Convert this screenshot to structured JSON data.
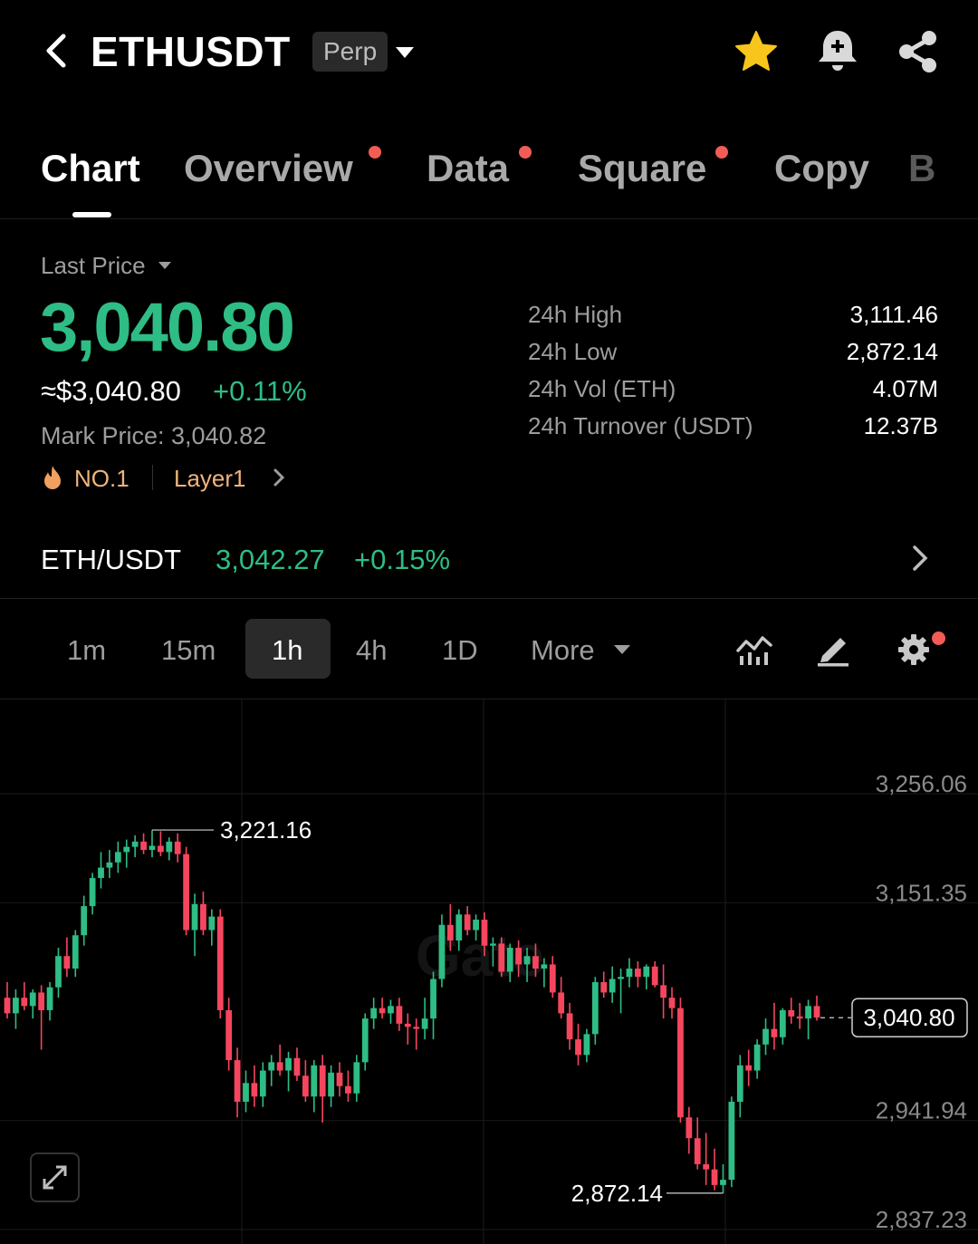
{
  "header": {
    "symbol": "ETHUSDT",
    "badge": "Perp"
  },
  "tabs": [
    {
      "label": "Chart",
      "active": true,
      "dot": false
    },
    {
      "label": "Overview",
      "active": false,
      "dot": true
    },
    {
      "label": "Data",
      "active": false,
      "dot": true
    },
    {
      "label": "Square",
      "active": false,
      "dot": true
    },
    {
      "label": "Copy",
      "active": false,
      "dot": false
    },
    {
      "label": "B",
      "active": false,
      "dot": false
    }
  ],
  "price": {
    "label": "Last Price",
    "last": "3,040.80",
    "usd": "≈$3,040.80",
    "change": "+0.11%",
    "mark": "Mark Price:  3,040.82",
    "rank": "NO.1",
    "tag": "Layer1"
  },
  "stats": [
    {
      "label": "24h High",
      "value": "3,111.46"
    },
    {
      "label": "24h Low",
      "value": "2,872.14"
    },
    {
      "label": "24h Vol (ETH)",
      "value": "4.07M"
    },
    {
      "label": "24h Turnover (USDT)",
      "value": "12.37B"
    }
  ],
  "spot": {
    "pair": "ETH/USDT",
    "price": "3,042.27",
    "change": "+0.15%"
  },
  "intervals": [
    {
      "label": "1m",
      "active": false
    },
    {
      "label": "15m",
      "active": false
    },
    {
      "label": "1h",
      "active": true
    },
    {
      "label": "4h",
      "active": false
    },
    {
      "label": "1D",
      "active": false
    },
    {
      "label": "More",
      "active": false
    }
  ],
  "colors": {
    "up": "#2ebd85",
    "down": "#f6465d",
    "accent": "#f0b47a",
    "dot": "#f25c54"
  },
  "chart_data": {
    "type": "candlestick",
    "y_ticks": [
      "3,256.06",
      "3,151.35",
      "2,941.94",
      "2,837.23"
    ],
    "ylim": [
      2830,
      3265
    ],
    "last_price_label": "3,040.80",
    "high_label": "3,221.16",
    "low_label": "2,872.14",
    "watermark": "Gate",
    "candles": [
      [
        3060,
        3075,
        3040,
        3045
      ],
      [
        3045,
        3068,
        3030,
        3060
      ],
      [
        3060,
        3075,
        3048,
        3052
      ],
      [
        3052,
        3068,
        3040,
        3065
      ],
      [
        3065,
        3072,
        3010,
        3048
      ],
      [
        3048,
        3075,
        3038,
        3070
      ],
      [
        3070,
        3108,
        3060,
        3100
      ],
      [
        3100,
        3118,
        3080,
        3088
      ],
      [
        3088,
        3125,
        3080,
        3120
      ],
      [
        3120,
        3158,
        3110,
        3148
      ],
      [
        3148,
        3180,
        3140,
        3175
      ],
      [
        3175,
        3200,
        3165,
        3185
      ],
      [
        3185,
        3202,
        3175,
        3190
      ],
      [
        3190,
        3210,
        3180,
        3200
      ],
      [
        3200,
        3212,
        3185,
        3205
      ],
      [
        3205,
        3216,
        3195,
        3210
      ],
      [
        3210,
        3218,
        3198,
        3202
      ],
      [
        3202,
        3221,
        3195,
        3206
      ],
      [
        3206,
        3220,
        3196,
        3200
      ],
      [
        3200,
        3214,
        3192,
        3210
      ],
      [
        3210,
        3218,
        3190,
        3198
      ],
      [
        3198,
        3205,
        3120,
        3125
      ],
      [
        3125,
        3160,
        3100,
        3150
      ],
      [
        3150,
        3162,
        3120,
        3125
      ],
      [
        3125,
        3145,
        3110,
        3138
      ],
      [
        3138,
        3145,
        3040,
        3048
      ],
      [
        3048,
        3060,
        2990,
        3000
      ],
      [
        3000,
        3012,
        2945,
        2960
      ],
      [
        2960,
        2990,
        2950,
        2978
      ],
      [
        2978,
        2995,
        2955,
        2965
      ],
      [
        2965,
        2998,
        2955,
        2990
      ],
      [
        2990,
        3005,
        2975,
        2998
      ],
      [
        2998,
        3015,
        2985,
        2990
      ],
      [
        2990,
        3008,
        2970,
        3002
      ],
      [
        3002,
        3012,
        2980,
        2985
      ],
      [
        2985,
        3000,
        2960,
        2965
      ],
      [
        2965,
        3000,
        2950,
        2995
      ],
      [
        2995,
        3005,
        2940,
        2965
      ],
      [
        2965,
        2995,
        2955,
        2988
      ],
      [
        2988,
        2998,
        2965,
        2975
      ],
      [
        2975,
        2990,
        2960,
        2968
      ],
      [
        2968,
        3005,
        2960,
        2998
      ],
      [
        2998,
        3045,
        2990,
        3040
      ],
      [
        3040,
        3060,
        3030,
        3050
      ],
      [
        3050,
        3060,
        3040,
        3045
      ],
      [
        3045,
        3058,
        3035,
        3052
      ],
      [
        3052,
        3060,
        3028,
        3035
      ],
      [
        3035,
        3045,
        3015,
        3032
      ],
      [
        3032,
        3040,
        3010,
        3030
      ],
      [
        3030,
        3060,
        3020,
        3040
      ],
      [
        3040,
        3085,
        3020,
        3078
      ],
      [
        3078,
        3140,
        3070,
        3130
      ],
      [
        3130,
        3150,
        3105,
        3115
      ],
      [
        3115,
        3145,
        3105,
        3140
      ],
      [
        3140,
        3148,
        3120,
        3125
      ],
      [
        3125,
        3140,
        3115,
        3135
      ],
      [
        3135,
        3142,
        3100,
        3110
      ],
      [
        3110,
        3118,
        3090,
        3112
      ],
      [
        3112,
        3118,
        3080,
        3085
      ],
      [
        3085,
        3112,
        3075,
        3108
      ],
      [
        3108,
        3115,
        3080,
        3092
      ],
      [
        3092,
        3108,
        3075,
        3100
      ],
      [
        3100,
        3112,
        3080,
        3088
      ],
      [
        3088,
        3098,
        3070,
        3092
      ],
      [
        3092,
        3100,
        3060,
        3065
      ],
      [
        3065,
        3080,
        3040,
        3045
      ],
      [
        3045,
        3055,
        3010,
        3020
      ],
      [
        3020,
        3035,
        2995,
        3005
      ],
      [
        3005,
        3030,
        2998,
        3025
      ],
      [
        3025,
        3080,
        3015,
        3075
      ],
      [
        3075,
        3085,
        3060,
        3065
      ],
      [
        3065,
        3090,
        3055,
        3078
      ],
      [
        3078,
        3088,
        3045,
        3080
      ],
      [
        3080,
        3098,
        3070,
        3088
      ],
      [
        3088,
        3095,
        3070,
        3080
      ],
      [
        3080,
        3092,
        3068,
        3090
      ],
      [
        3090,
        3095,
        3070,
        3072
      ],
      [
        3072,
        3092,
        3040,
        3060
      ],
      [
        3060,
        3070,
        3040,
        3050
      ],
      [
        3050,
        3060,
        2940,
        2945
      ],
      [
        2945,
        2955,
        2910,
        2925
      ],
      [
        2925,
        2945,
        2895,
        2900
      ],
      [
        2900,
        2930,
        2880,
        2895
      ],
      [
        2895,
        2915,
        2875,
        2880
      ],
      [
        2880,
        2900,
        2872,
        2885
      ],
      [
        2885,
        2965,
        2878,
        2960
      ],
      [
        2960,
        3005,
        2945,
        2995
      ],
      [
        2995,
        3010,
        2975,
        2990
      ],
      [
        2990,
        3020,
        2982,
        3015
      ],
      [
        3015,
        3040,
        3005,
        3030
      ],
      [
        3030,
        3055,
        3010,
        3022
      ],
      [
        3022,
        3050,
        3015,
        3048
      ],
      [
        3048,
        3060,
        3035,
        3042
      ],
      [
        3042,
        3055,
        3030,
        3040
      ],
      [
        3040,
        3058,
        3020,
        3052
      ],
      [
        3052,
        3062,
        3038,
        3041
      ]
    ]
  }
}
